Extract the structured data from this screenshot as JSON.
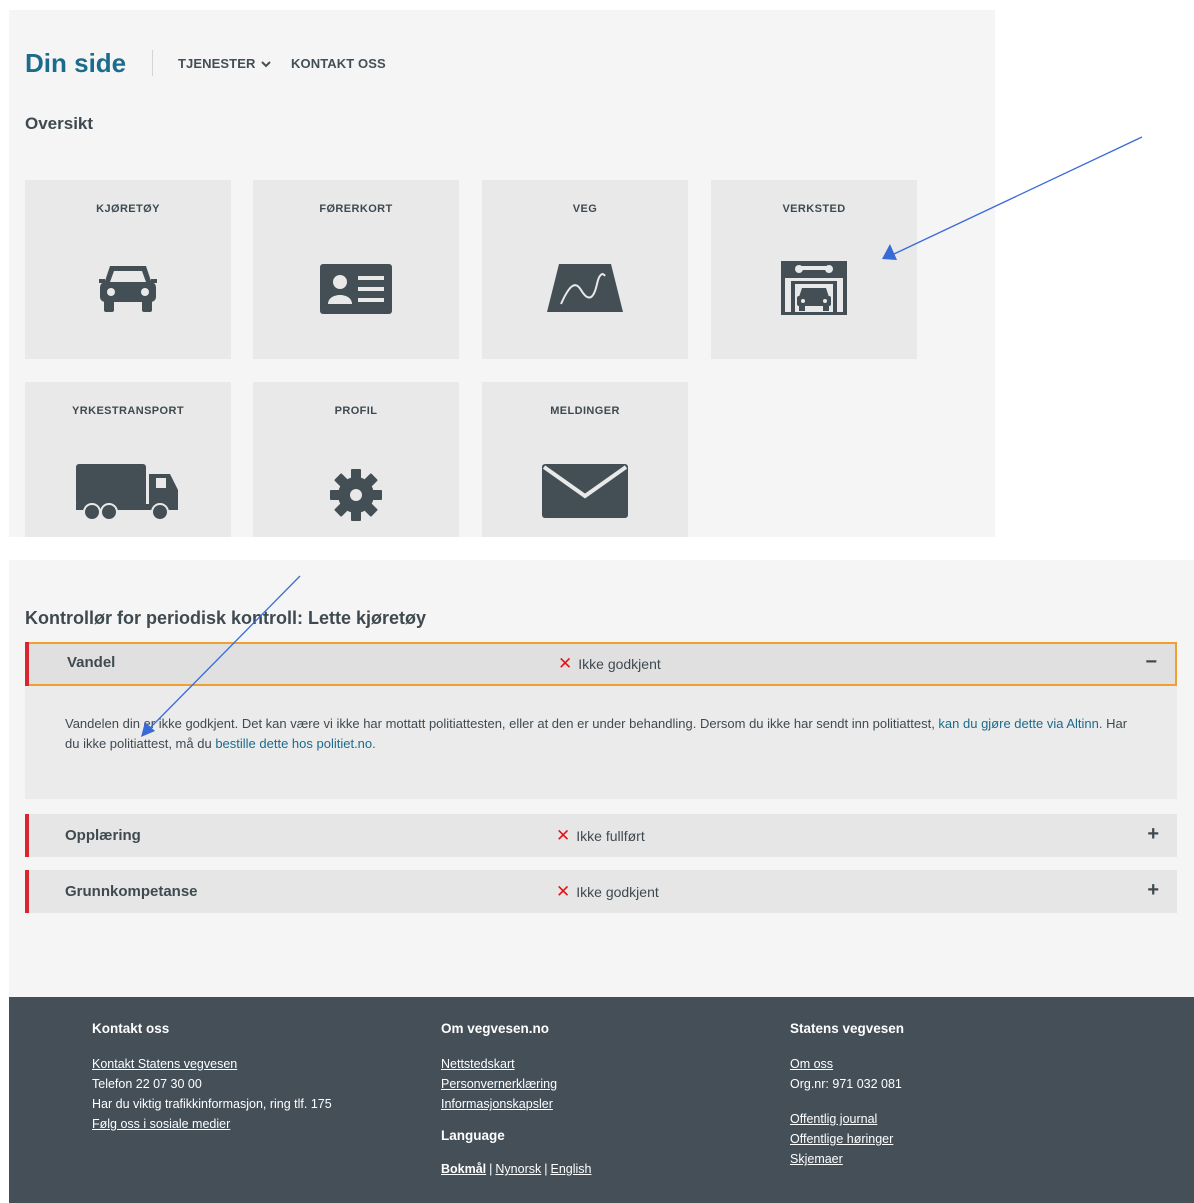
{
  "header": {
    "brand": "Din side",
    "nav": {
      "tjenester": "TJENESTER",
      "kontakt": "KONTAKT OSS"
    }
  },
  "overview": {
    "title": "Oversikt",
    "tiles": [
      {
        "label": "KJØRETØY",
        "icon": "car-icon"
      },
      {
        "label": "FØRERKORT",
        "icon": "id-card-icon"
      },
      {
        "label": "VEG",
        "icon": "road-icon"
      },
      {
        "label": "VERKSTED",
        "icon": "workshop-icon"
      },
      {
        "label": "YRKESTRANSPORT",
        "icon": "truck-icon"
      },
      {
        "label": "PROFIL",
        "icon": "gear-icon"
      },
      {
        "label": "MELDINGER",
        "icon": "envelope-icon"
      }
    ]
  },
  "section": {
    "title": "Kontrollør for periodisk kontroll: Lette kjøretøy",
    "items": [
      {
        "name": "Vandel",
        "status": "Ikke godkjent",
        "toggle": "−",
        "body_pre": "Vandelen din er ikke godkjent. Det kan være vi ikke har mottatt politiattesten, eller at den er under behandling. Dersom du ikke har sendt inn politiattest, ",
        "body_link1": "kan du gjøre dette via Altinn.",
        "body_mid": " Har du ikke politiattest, må du ",
        "body_link2": "bestille dette hos politiet.no."
      },
      {
        "name": "Opplæring",
        "status": "Ikke fullført",
        "toggle": "+"
      },
      {
        "name": "Grunnkompetanse",
        "status": "Ikke godkjent",
        "toggle": "+"
      }
    ],
    "status_symbol": "✕"
  },
  "footer": {
    "contact": {
      "title": "Kontakt oss",
      "link": "Kontakt Statens vegvesen",
      "phone": "Telefon 22 07 30 00",
      "traffic": "Har du viktig trafikkinformasjon, ring tlf. 175",
      "social": "Følg oss i sosiale medier"
    },
    "about": {
      "title": "Om vegvesen.no",
      "links": [
        "Nettstedskart",
        "Personvernerklæring",
        "Informasjonskapsler"
      ],
      "language_title": "Language",
      "languages": [
        "Bokmål",
        "Nynorsk",
        "English"
      ],
      "sep": "|"
    },
    "agency": {
      "title": "Statens vegvesen",
      "about": "Om oss",
      "org": "Org.nr: 971 032 081",
      "links": [
        "Offentlig journal",
        "Offentlige høringer",
        "Skjemaer"
      ]
    }
  },
  "colors": {
    "brand": "#1b6c8c",
    "status_red": "#e0161a",
    "bar_red": "#d8262e",
    "focus": "#f0a030",
    "footer_bg": "#444f58",
    "annotation_arrow": "#3a6ad8"
  }
}
